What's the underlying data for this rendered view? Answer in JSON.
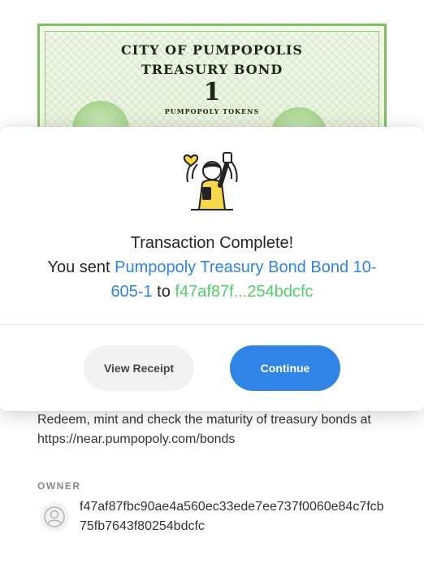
{
  "bond": {
    "line1": "CITY OF PUMPOPOLIS",
    "line2": "TREASURY BOND",
    "denomination": "1",
    "line3": "PUMPOPOLY TOKENS"
  },
  "description": "Redeem, mint and check the maturity of treasury bonds at https://near.pumpopoly.com/bonds",
  "owner": {
    "label": "OWNER",
    "value": "f47af87fbc90ae4a560ec33ede7ee737f0060e84c7fcb75fb7643f80254bdcfc"
  },
  "modal": {
    "title": "Transaction Complete!",
    "sent_prefix": "You sent",
    "item": "Pumpopoly Treasury Bond Bond 10-605-1",
    "to_word": "to",
    "recipient": "f47af87f...254bdcfc",
    "receipt_label": "View Receipt",
    "continue_label": "Continue",
    "illustration": "celebrating-person-illustration"
  },
  "colors": {
    "accent_blue": "#2f84e6",
    "accent_green": "#4fd16c"
  }
}
